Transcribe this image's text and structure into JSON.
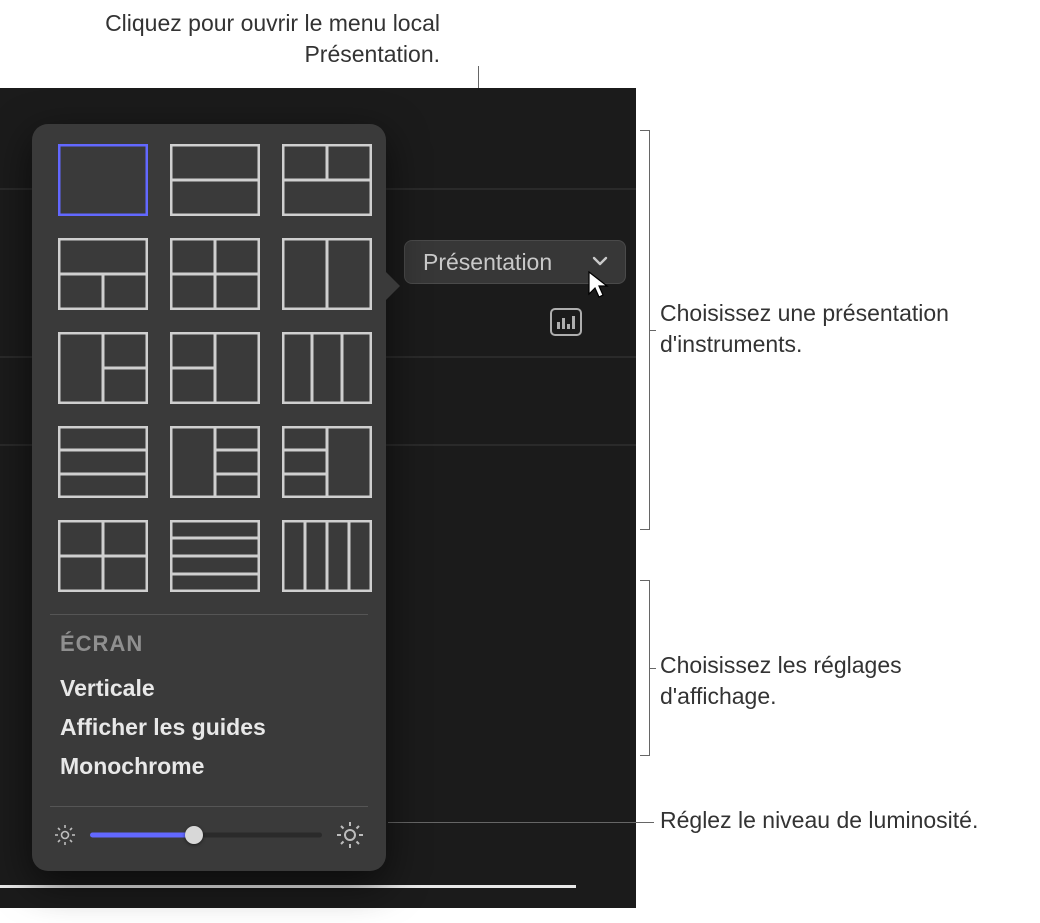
{
  "captions": {
    "top": "Cliquez pour ouvrir le menu local Présentation.",
    "layouts": "Choisissez une présentation d'instruments.",
    "display": "Choisissez les réglages d'affichage.",
    "brightness": "Réglez le niveau de luminosité."
  },
  "button": {
    "label": "Présentation"
  },
  "menu": {
    "heading": "ÉCRAN",
    "items": [
      "Verticale",
      "Afficher les guides",
      "Monochrome"
    ]
  },
  "slider": {
    "value_percent": 45
  },
  "layouts": {
    "count": 15,
    "selected_index": 0
  },
  "colors": {
    "accent": "#6268ff",
    "panel": "#3a3a3a",
    "stroke": "#cfcfcf"
  }
}
